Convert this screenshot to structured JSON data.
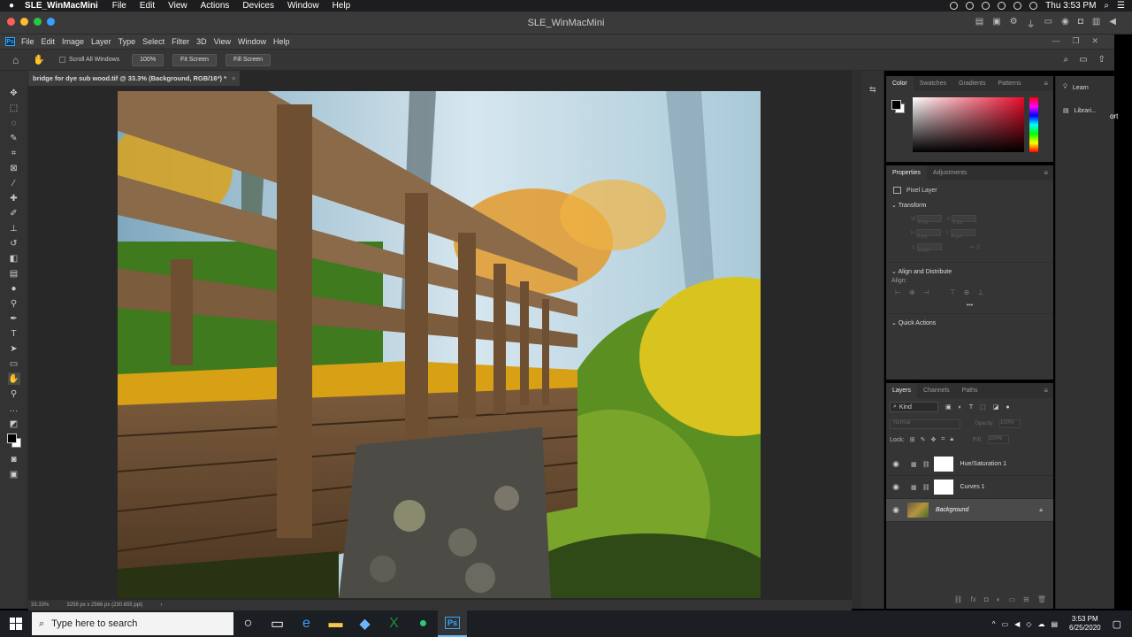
{
  "mac": {
    "apple": "",
    "app": "SLE_WinMacMini",
    "menus": [
      "File",
      "Edit",
      "View",
      "Actions",
      "Devices",
      "Window",
      "Help"
    ],
    "clock": "Thu 3:53 PM"
  },
  "window": {
    "title": "SLE_WinMacMini"
  },
  "ps_menu": {
    "logo": "Ps",
    "items": [
      "File",
      "Edit",
      "Image",
      "Layer",
      "Type",
      "Select",
      "Filter",
      "3D",
      "View",
      "Window",
      "Help"
    ]
  },
  "options": {
    "scroll_all": "Scroll All Windows",
    "zoom": "100%",
    "fit": "Fit Screen",
    "fill": "Fill Screen"
  },
  "document": {
    "tab": "bridge for dye sub wood.tif @ 33.3% (Background, RGB/16*) *",
    "close": "×"
  },
  "status": {
    "zoom": "33.33%",
    "info": "3258 px x 2566 px (230.655 ppi)",
    "arrow": "›"
  },
  "color_panel": {
    "tabs": [
      "Color",
      "Swatches",
      "Gradients",
      "Patterns"
    ],
    "active": "Color"
  },
  "properties": {
    "tabs": [
      "Properties",
      "Adjustments"
    ],
    "active": "Properties",
    "layer_type": "Pixel Layer",
    "transform": "Transform",
    "w": "W",
    "w_val": "0 px",
    "x": "X",
    "x_val": "0 px",
    "h": "H",
    "h_val": "0 px",
    "y": "Y",
    "y_val": "0 px",
    "angle": "0.00°",
    "align": "Align and Distribute",
    "align_label": "Align:",
    "more": "•••",
    "quick": "Quick Actions"
  },
  "layers": {
    "tabs": [
      "Layers",
      "Channels",
      "Paths"
    ],
    "active": "Layers",
    "kind": "Kind",
    "blend": "Normal",
    "opacity_label": "Opacity:",
    "opacity": "100%",
    "lock_label": "Lock:",
    "fill_label": "Fill:",
    "fill": "100%",
    "items": [
      {
        "name": "Hue/Saturation 1"
      },
      {
        "name": "Curves 1"
      },
      {
        "name": "Background"
      }
    ]
  },
  "learn": {
    "learn": "Learn",
    "libraries": "Librari...",
    "partial": "ort"
  },
  "taskbar": {
    "search_placeholder": "Type here to search",
    "time": "3:53 PM",
    "date": "6/25/2020"
  },
  "colors": {
    "accent": "#31a8ff",
    "fg_swatch": "#000000",
    "bg_swatch": "#ffffff"
  }
}
